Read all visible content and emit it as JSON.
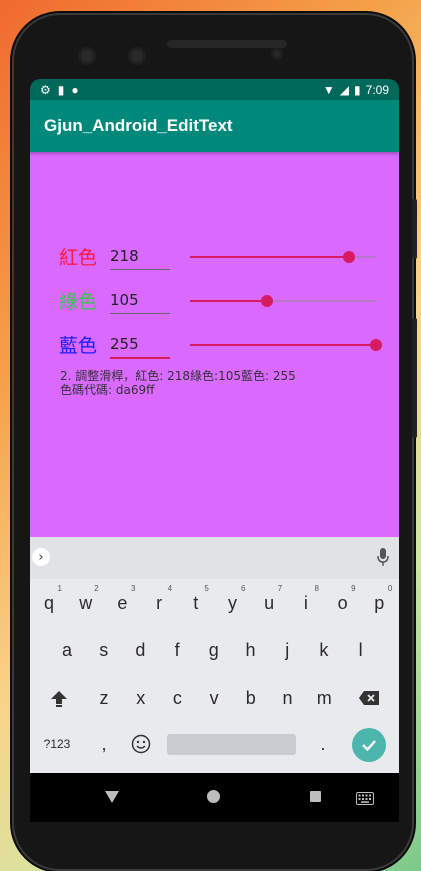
{
  "status_bar": {
    "time": "7:09"
  },
  "app_bar": {
    "title": "Gjun_Android_EditText"
  },
  "rows": [
    {
      "label": "紅色",
      "value": "218",
      "color": "#ff1744",
      "level": 0.855
    },
    {
      "label": "綠色",
      "value": "105",
      "color": "#2ecc40",
      "level": 0.412
    },
    {
      "label": "藍色",
      "value": "255",
      "color": "#1d1dff",
      "level": 1.0
    }
  ],
  "info": {
    "line1": "2. 調整滑桿，紅色: 218綠色:105藍色: 255",
    "line2": "色碼代碼: da69ff"
  },
  "content_bg": "#da69ff",
  "keyboard": {
    "row1": [
      {
        "k": "q",
        "n": "1"
      },
      {
        "k": "w",
        "n": "2"
      },
      {
        "k": "e",
        "n": "3"
      },
      {
        "k": "r",
        "n": "4"
      },
      {
        "k": "t",
        "n": "5"
      },
      {
        "k": "y",
        "n": "6"
      },
      {
        "k": "u",
        "n": "7"
      },
      {
        "k": "i",
        "n": "8"
      },
      {
        "k": "o",
        "n": "9"
      },
      {
        "k": "p",
        "n": "0"
      }
    ],
    "row2": [
      "a",
      "s",
      "d",
      "f",
      "g",
      "h",
      "j",
      "k",
      "l"
    ],
    "row3": [
      "z",
      "x",
      "c",
      "v",
      "b",
      "n",
      "m"
    ],
    "sym_label": "?123",
    "comma": ",",
    "period": "."
  }
}
